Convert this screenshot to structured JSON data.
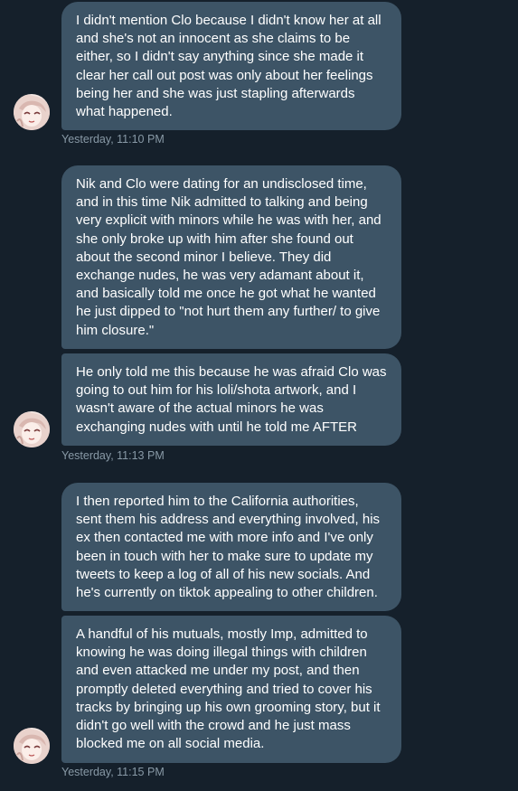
{
  "conversation": {
    "messages": [
      "I didn't mention Clo because I didn't know her at all\nand she's not an innocent as she claims to be\neither, so I didn't say anything since she made it\nclear her call out post was only about her feelings\nbeing her and she was just stapling afterwards\nwhat happened.",
      "Nik and Clo were dating for an undisclosed time,\nand in this time Nik admitted to talking and being\nvery explicit with minors while he was with her, and\nshe only broke up with him after she found out\nabout the second minor I believe. They did\nexchange nudes, he was very adamant about it,\nand basically told me once he got what he wanted\nhe just dipped to \"not hurt them any further/ to give\nhim closure.\"",
      "He only told me this because he was afraid Clo was\ngoing to out him for his loli/shota artwork, and I\nwasn't aware of the actual minors he was\nexchanging nudes with until he told me AFTER",
      "I then reported him to the California authorities,\nsent them his address and everything involved, his\nex then contacted me with more info and I've only\nbeen in touch with her to make sure to update my\ntweets to keep a log of all of his new socials. And\nhe's currently on tiktok appealing to other children.",
      "A handful of his mutuals, mostly Imp, admitted to\nknowing he was doing illegal things with children\nand even attacked me under my post, and then\npromptly deleted everything and tried to cover his\ntracks by bringing up his own grooming story, but it\ndidn't go well with the crowd and he just mass\nblocked me on all social media."
    ],
    "timestamps": [
      "Yesterday, 11:10 PM",
      "Yesterday, 11:13 PM",
      "Yesterday, 11:15 PM"
    ]
  },
  "colors": {
    "background": "#15202b",
    "bubble": "#3d5466",
    "timestamp": "#8899a6"
  },
  "avatar": {
    "icon": "anime-girl-avatar"
  }
}
